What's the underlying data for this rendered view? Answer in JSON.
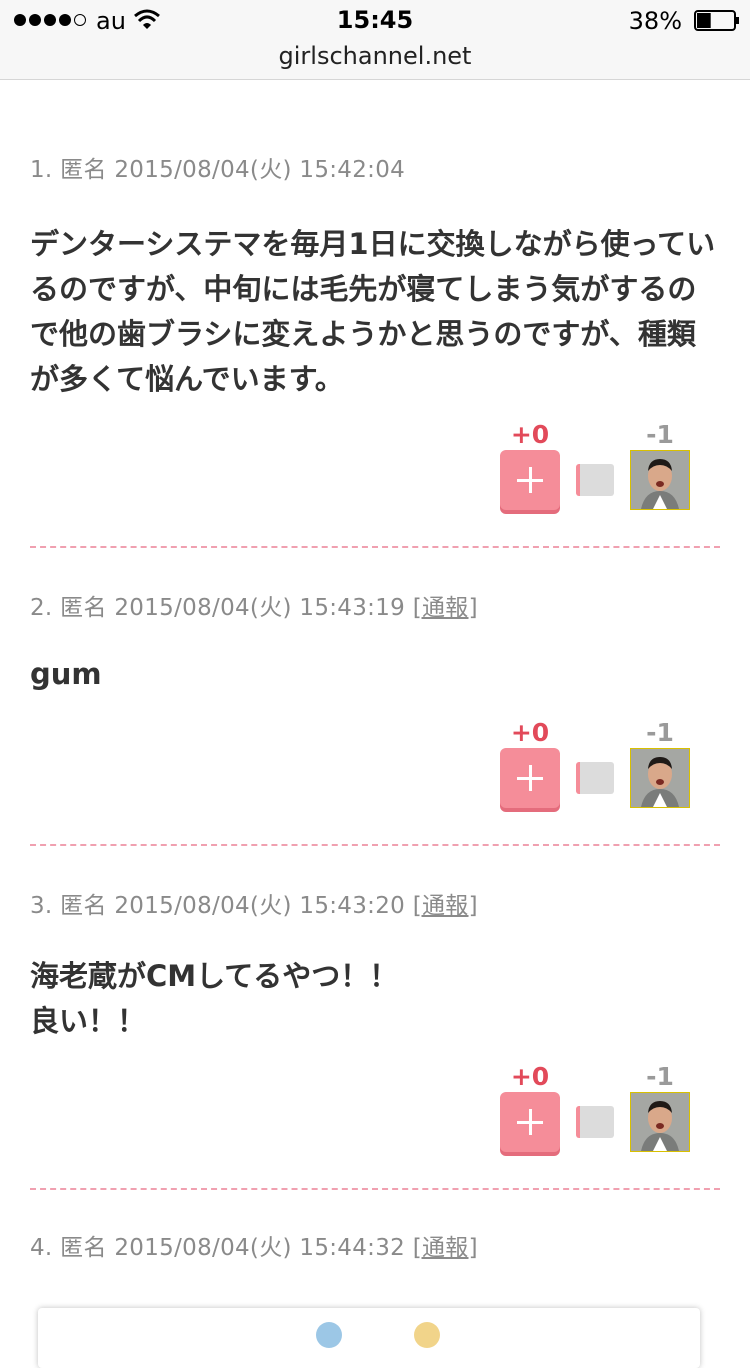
{
  "status_bar": {
    "carrier": "au",
    "time": "15:45",
    "battery_percent": "38%",
    "battery_level": 0.38,
    "signal_bars": 4
  },
  "url_bar": {
    "host": "girlschannel.net"
  },
  "comments": [
    {
      "meta": "1. 匿名 2015/08/04(火) 15:42:04",
      "report": "",
      "body": "デンターシステマを毎月1日に交換しながら使っているのですが、中旬には毛先が寝てしまう気がするので他の歯ブラシに変えようかと思うのですが、種類が多くて悩んでいます。",
      "plus": "+0",
      "minus": "-1"
    },
    {
      "meta": "2. 匿名 2015/08/04(火) 15:43:19 ",
      "report": "[通報]",
      "body": "gum",
      "plus": "+0",
      "minus": "-1"
    },
    {
      "meta": "3. 匿名 2015/08/04(火) 15:43:20 ",
      "report": "[通報]",
      "body": "海老蔵がCMしてるやつ！！\n良い！！",
      "plus": "+0",
      "minus": "-1"
    },
    {
      "meta": "4. 匿名 2015/08/04(火) 15:44:32 ",
      "report": "[通報]"
    }
  ],
  "colors": {
    "plus_accent": "#e24a5a",
    "plus_button": "#f58d99",
    "divider": "#f0a0b0",
    "meta_text": "#8a8a8a"
  }
}
